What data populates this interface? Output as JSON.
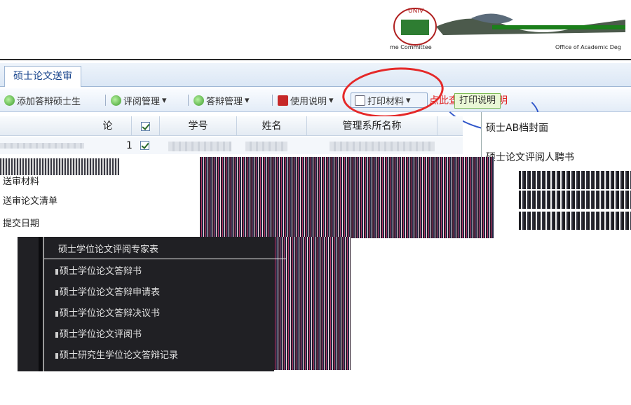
{
  "banner": {
    "logo_text_left": "me Committee",
    "logo_text_right": "Office of Academic Deg",
    "logo_seal_text": "UNIV"
  },
  "tabs": [
    {
      "label": "硕士论文送审"
    }
  ],
  "toolbar": {
    "items": [
      {
        "label": "添加答辩硕士生",
        "icon": "add-icon"
      },
      {
        "label": "评阅管理",
        "icon": "review-icon"
      },
      {
        "label": "答辩管理",
        "icon": "defense-icon"
      },
      {
        "label": "使用说明",
        "icon": "help-icon"
      },
      {
        "label": "打印材料",
        "icon": "print-icon"
      }
    ],
    "help_link": "点此查看打印说明",
    "right_button": "打印说明"
  },
  "grid": {
    "columns": [
      "论",
      "",
      "学号",
      "姓名",
      "管理系所名称"
    ],
    "rows": [
      {
        "num": "1",
        "checked": true
      }
    ]
  },
  "print_menu": {
    "items": [
      "硕士AB档封面",
      "硕士论文评阅人聘书"
    ]
  },
  "left_fragments": [
    "送审材料",
    "送审论文清单",
    "提交日期"
  ],
  "submenu": {
    "title": "硕士学位论文评阅专家表",
    "items": [
      "硕士学位论文答辩书",
      "硕士学位论文答辩申请表",
      "硕士学位论文答辩决议书",
      "硕士学位论文评阅书",
      "硕士研究生学位论文答辩记录"
    ]
  },
  "colors": {
    "tab_text": "#15428b",
    "accent_red": "#e52828",
    "menu_bg": "#202024"
  }
}
